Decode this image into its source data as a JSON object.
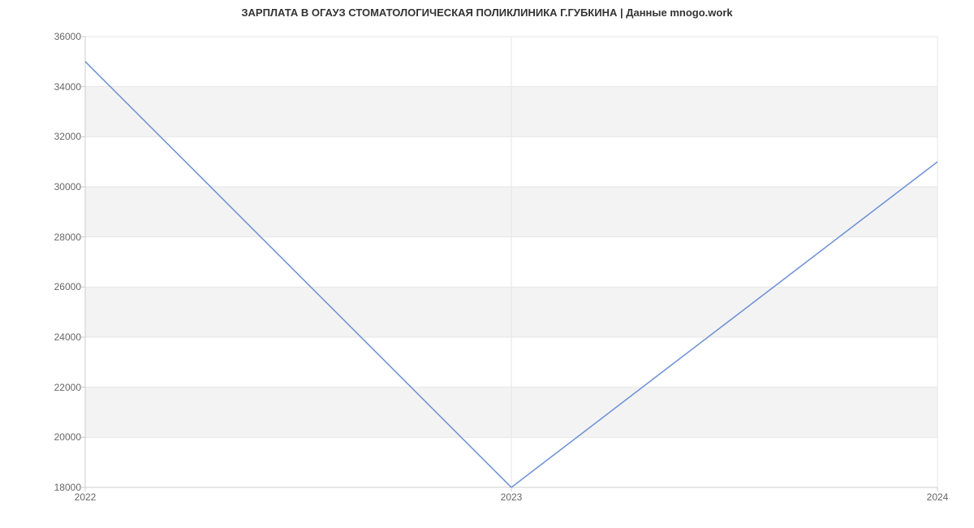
{
  "chart_data": {
    "type": "line",
    "title": "ЗАРПЛАТА В ОГАУЗ СТОМАТОЛОГИЧЕСКАЯ ПОЛИКЛИНИКА Г.ГУБКИНА | Данные mnogo.work",
    "x": [
      2022,
      2023,
      2024
    ],
    "values": [
      35000,
      18000,
      31000
    ],
    "xlabel": "",
    "ylabel": "",
    "xlim": [
      2022,
      2024
    ],
    "ylim": [
      18000,
      36000
    ],
    "y_ticks": [
      18000,
      20000,
      22000,
      24000,
      26000,
      28000,
      30000,
      32000,
      34000,
      36000
    ],
    "x_ticks": [
      2022,
      2023,
      2024
    ],
    "line_color": "#6b8fd6",
    "band_color": "#f3f3f3",
    "grid_line_color": "#e6e6e6",
    "axis_line_color": "#cccccc"
  }
}
